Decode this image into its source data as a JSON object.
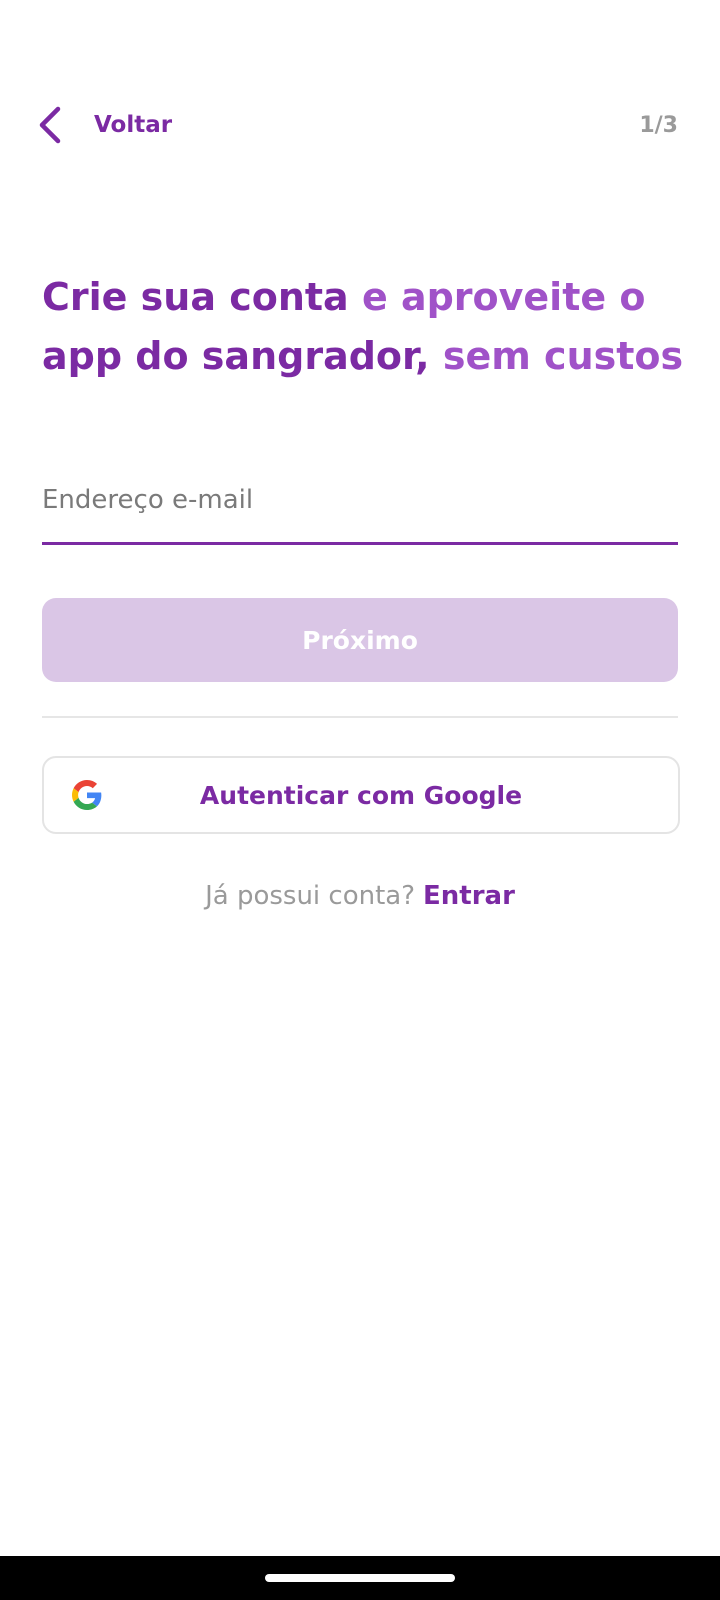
{
  "header": {
    "back_label": "Voltar",
    "step": "1/3"
  },
  "headline": {
    "line1_dark": "Crie sua conta",
    "line1_light": "e aproveite o",
    "line2_dark": "app do sangrador,",
    "line2_light": "sem custos"
  },
  "form": {
    "email_placeholder": "Endereço e-mail",
    "email_value": "",
    "next_label": "Próximo"
  },
  "google": {
    "label": "Autenticar com Google"
  },
  "login": {
    "question": "Já possui conta?",
    "link": "Entrar"
  },
  "colors": {
    "primary": "#7b2aa3",
    "primary_light": "#a052c8",
    "disabled_button": "#dac6e6",
    "muted_text": "#9a9a9a"
  },
  "icons": {
    "back": "chevron-left-icon",
    "google": "google-logo-icon"
  }
}
